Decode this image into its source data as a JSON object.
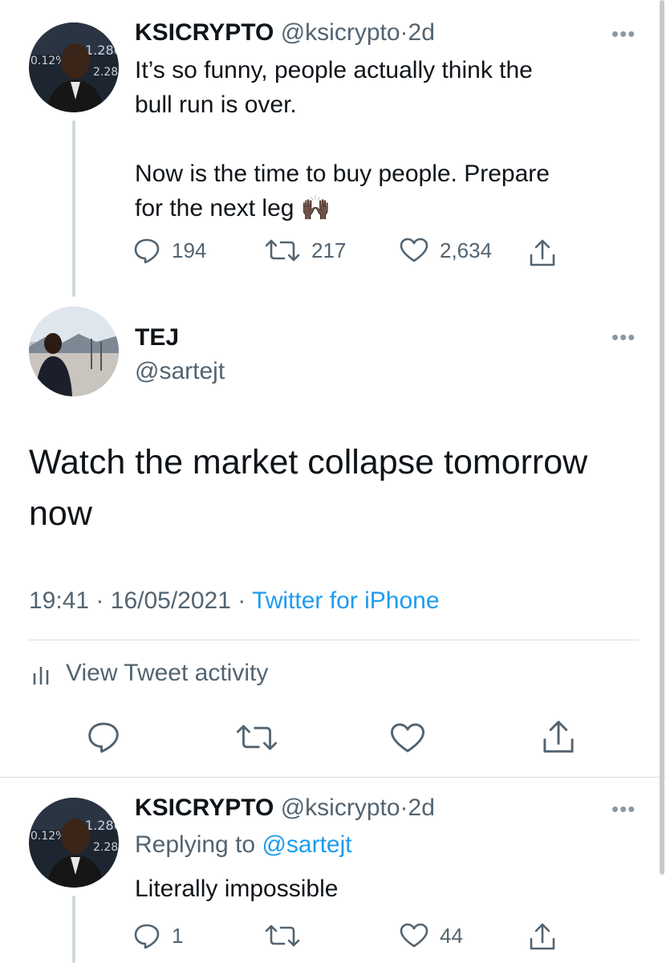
{
  "tweet1": {
    "name": "KSICRYPTO",
    "handle": "@ksicrypto",
    "sep": "·",
    "time": "2d",
    "text_lines": [
      "It’s so funny, people actually think the",
      "bull run is over."
    ],
    "text2_lines": [
      "Now is the time to buy people. Prepare",
      "for the next leg 🙌🏿"
    ],
    "replies": "194",
    "retweets": "217",
    "likes": "2,634"
  },
  "tweet2": {
    "name": "TEJ",
    "handle": "@sartejt",
    "text_lines": [
      "Watch the market collapse tomorrow",
      "now"
    ],
    "time": "19:41",
    "sep": "·",
    "date": "16/05/2021",
    "sep2": "·",
    "source": "Twitter for iPhone",
    "activity_label": "View Tweet activity"
  },
  "tweet3": {
    "name": "KSICRYPTO",
    "handle": "@ksicrypto",
    "sep": "·",
    "time": "2d",
    "replying_prefix": "Replying to",
    "replying_to": "@sartejt",
    "text": "Literally impossible",
    "replies": "1",
    "likes": "44"
  },
  "icons": {
    "more": "more-horizontal-icon",
    "reply": "reply-icon",
    "retweet": "retweet-icon",
    "like": "heart-icon",
    "share": "share-icon",
    "activity": "bar-chart-icon"
  },
  "colors": {
    "link": "#1d9bf0",
    "muted": "#536471",
    "text": "#0f1419"
  }
}
